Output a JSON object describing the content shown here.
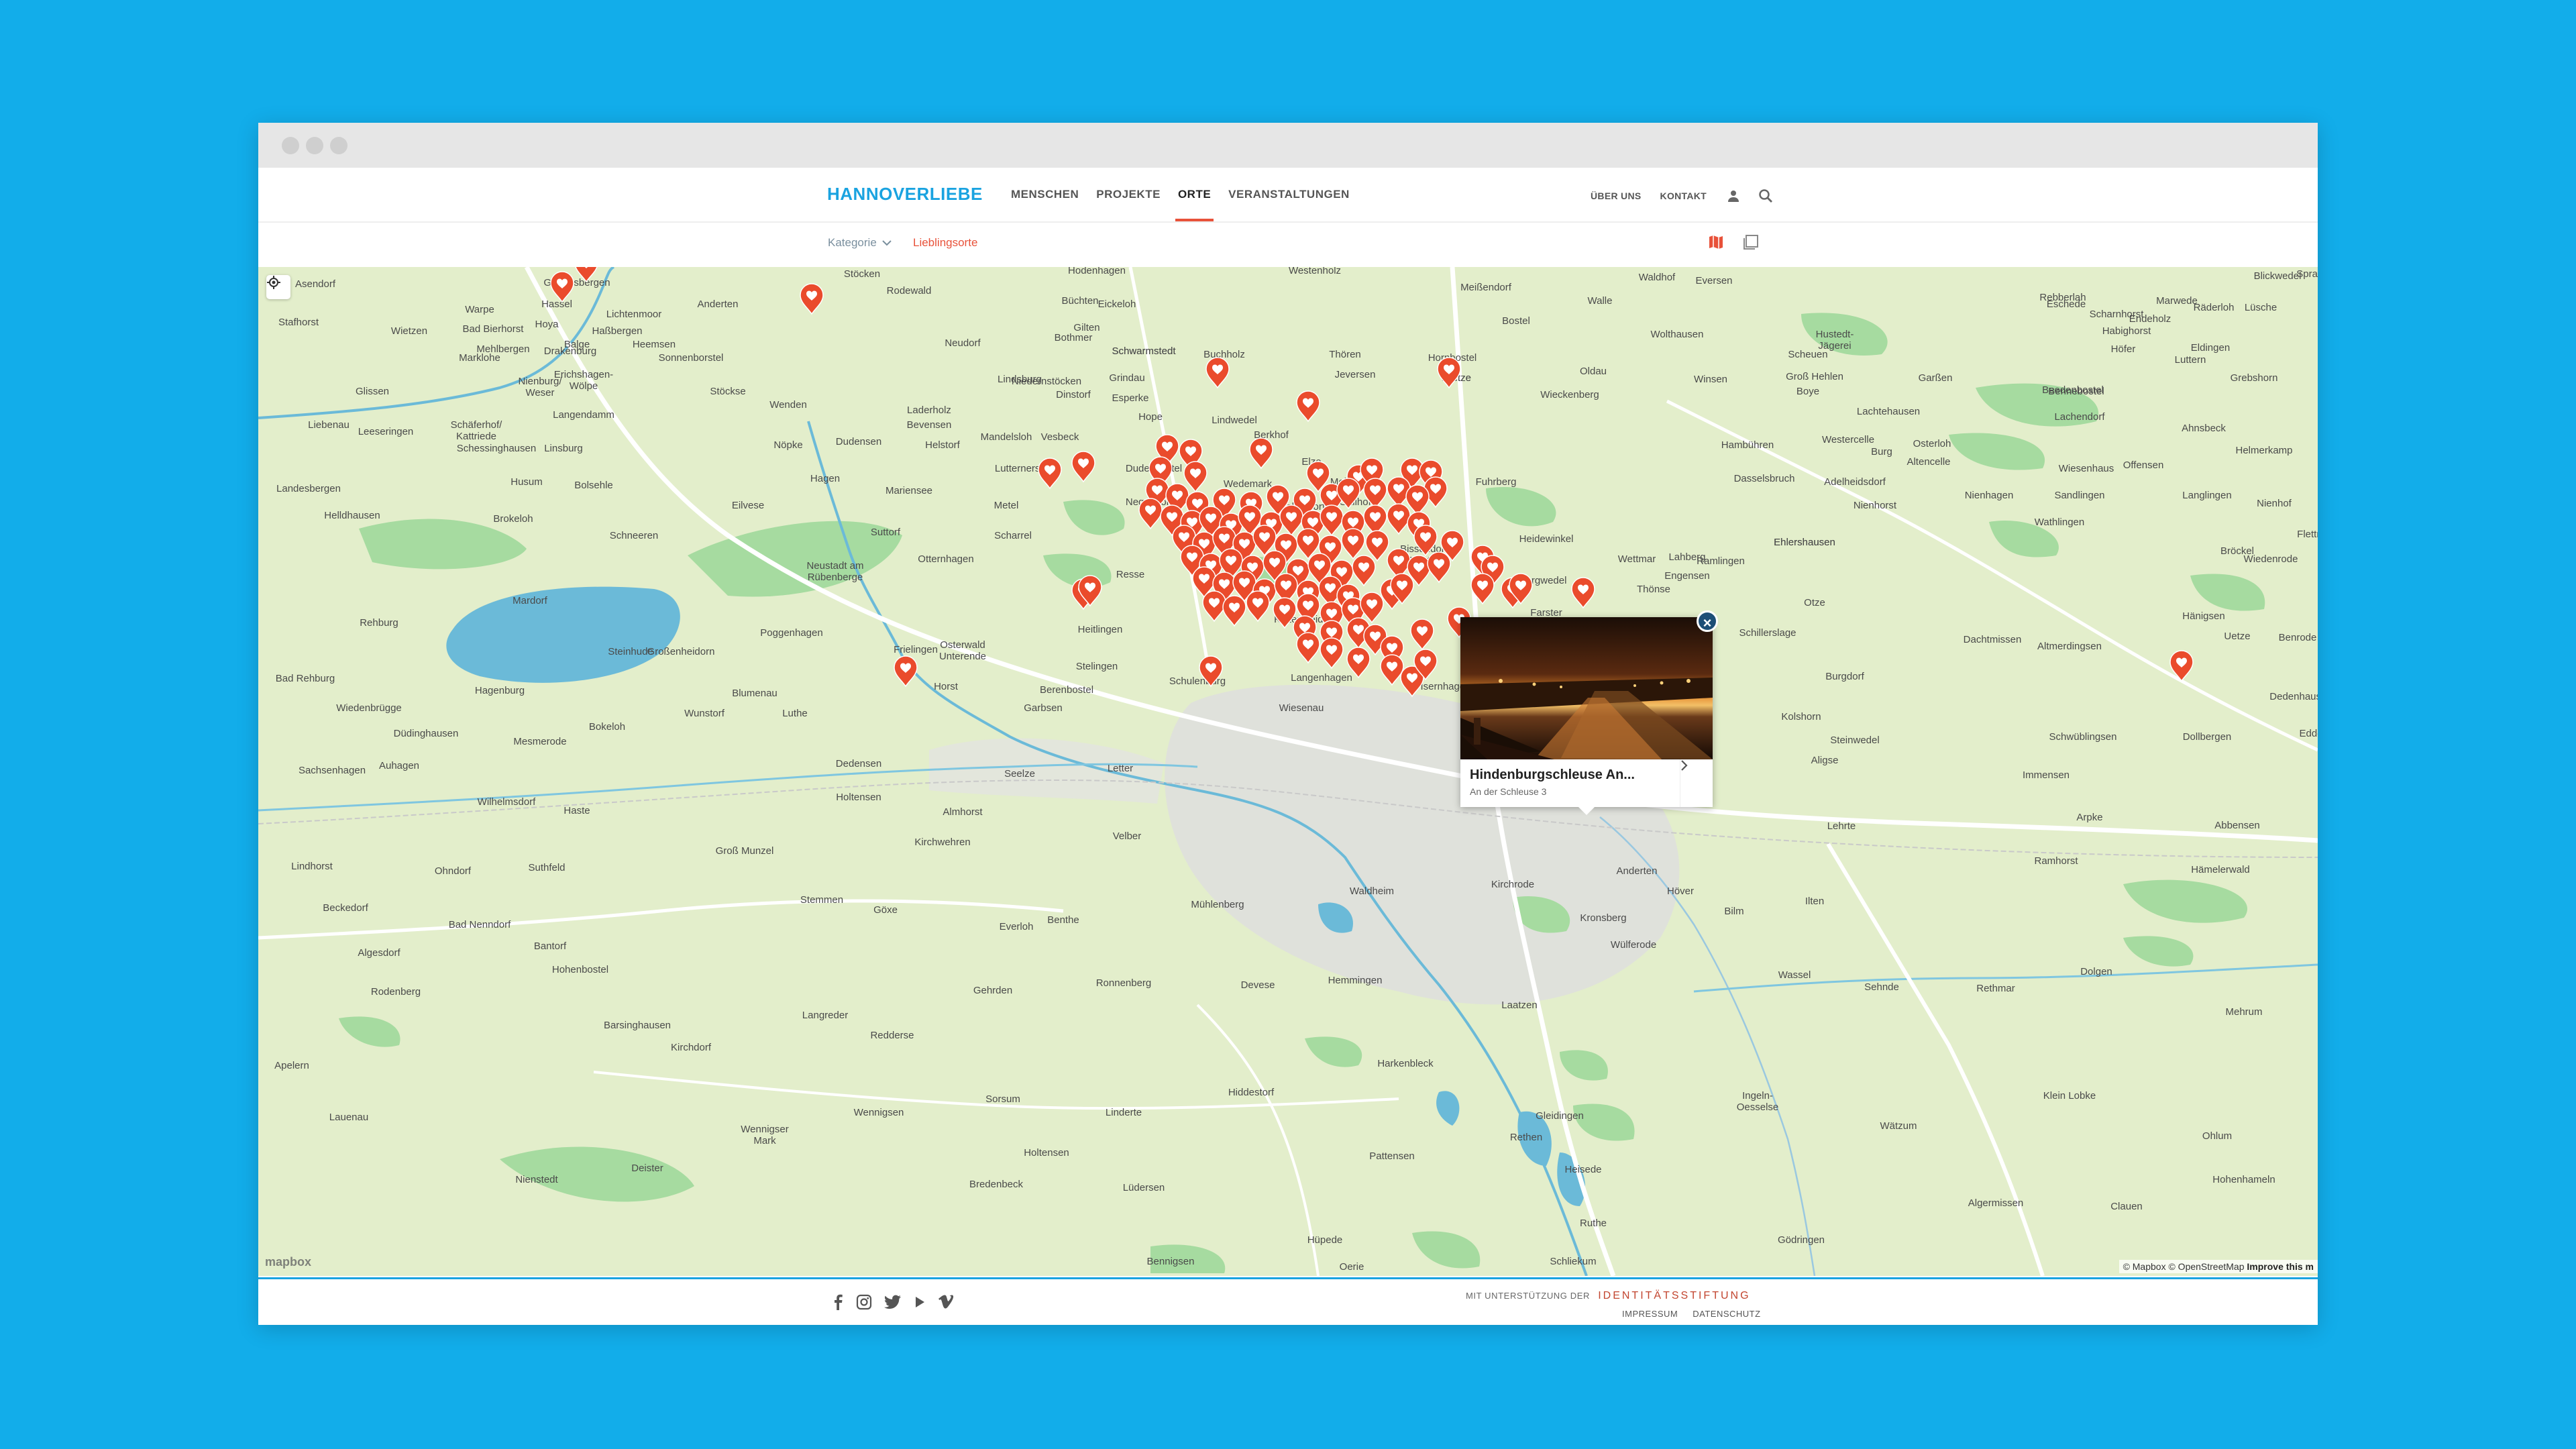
{
  "header": {
    "logo": "HANNOVERLIEBE",
    "nav": [
      {
        "label": "MENSCHEN",
        "active": false
      },
      {
        "label": "PROJEKTE",
        "active": false
      },
      {
        "label": "ORTE",
        "active": true
      },
      {
        "label": "VERANSTALTUNGEN",
        "active": false
      }
    ],
    "util": {
      "about": "ÜBER UNS",
      "contact": "KONTAKT"
    }
  },
  "subheader": {
    "category": "Kategorie",
    "favorites": "Lieblingsorte"
  },
  "map": {
    "attribution": {
      "mapbox": "© Mapbox",
      "osm": "© OpenStreetMap",
      "improve": "Improve this m"
    },
    "logo": "mapbox",
    "places": [
      [
        "Asendorf",
        85,
        30
      ],
      [
        "Stafhorst",
        60,
        87
      ],
      [
        "Warpe",
        330,
        68
      ],
      [
        "Bad Bierhorst",
        350,
        97
      ],
      [
        "Wietzen",
        225,
        100
      ],
      [
        "Gandesbergen",
        475,
        28
      ],
      [
        "Hassel",
        445,
        60
      ],
      [
        "Hoya",
        430,
        90
      ],
      [
        "Balge",
        475,
        120
      ],
      [
        "Haßbergen",
        535,
        100
      ],
      [
        "Marklohe",
        330,
        140
      ],
      [
        "Mehlbergen",
        365,
        127
      ],
      [
        "Drakenburg",
        465,
        130
      ],
      [
        "Heemsen",
        590,
        120
      ],
      [
        "Sonnenborstel",
        645,
        140
      ],
      [
        "Lichtenmoor",
        560,
        75
      ],
      [
        "Anderten",
        685,
        60
      ],
      [
        "Nienburg/\nWeser",
        420,
        175
      ],
      [
        "Erichshagen-\nWölpe",
        485,
        165
      ],
      [
        "Glissen",
        170,
        190
      ],
      [
        "Liebenau",
        105,
        240
      ],
      [
        "Leeseringen",
        190,
        250
      ],
      [
        "Schäferhof/\nKattriede",
        325,
        240
      ],
      [
        "Langendamm",
        485,
        225
      ],
      [
        "Stöckse",
        700,
        190
      ],
      [
        "Wenden",
        790,
        210
      ],
      [
        "Schessinghausen",
        355,
        275
      ],
      [
        "Linsburg",
        455,
        275
      ],
      [
        "Nöpke",
        790,
        270
      ],
      [
        "Dudensen",
        895,
        265
      ],
      [
        "Hagen",
        845,
        320
      ],
      [
        "Husum",
        400,
        325
      ],
      [
        "Bolsehle",
        500,
        330
      ],
      [
        "Brokeloh",
        380,
        380
      ],
      [
        "Eilvese",
        730,
        360
      ],
      [
        "Mariensee",
        970,
        338
      ],
      [
        "Schneeren",
        560,
        405
      ],
      [
        "Landesbergen",
        75,
        335
      ],
      [
        "Helldhausen",
        140,
        375
      ],
      [
        "Stöcken",
        900,
        15
      ],
      [
        "Rodewald",
        970,
        40
      ],
      [
        "Suttorf",
        935,
        400
      ],
      [
        "Mardorf",
        405,
        502
      ],
      [
        "Neustadt am\nRübenberge",
        860,
        450
      ],
      [
        "Rehburg",
        180,
        535
      ],
      [
        "Steinhude",
        555,
        578
      ],
      [
        "Großenheidorn",
        630,
        578
      ],
      [
        "Poggenhagen",
        795,
        550
      ],
      [
        "Bad Rehburg",
        70,
        618
      ],
      [
        "Hagenburg",
        360,
        636
      ],
      [
        "Wunstorf",
        665,
        670
      ],
      [
        "Blumenau",
        740,
        640
      ],
      [
        "Luthe",
        800,
        670
      ],
      [
        "Wiedenbrügge",
        165,
        662
      ],
      [
        "Bokeloh",
        520,
        690
      ],
      [
        "Düdinghausen",
        250,
        700
      ],
      [
        "Mesmerode",
        420,
        712
      ],
      [
        "Sachsenhagen",
        110,
        755
      ],
      [
        "Auhagen",
        210,
        748
      ],
      [
        "Dedensen",
        895,
        745
      ],
      [
        "Seelze",
        1135,
        760
      ],
      [
        "Letter",
        1285,
        752
      ],
      [
        "Wilhelmsdorf",
        370,
        802
      ],
      [
        "Haste",
        475,
        815
      ],
      [
        "Holtensen",
        895,
        795
      ],
      [
        "Almhorst",
        1050,
        817
      ],
      [
        "Kirchwehren",
        1020,
        862
      ],
      [
        "Velber",
        1295,
        853
      ],
      [
        "Lindhorst",
        80,
        898
      ],
      [
        "Ohndorf",
        290,
        905
      ],
      [
        "Suthfeld",
        430,
        900
      ],
      [
        "Groß Munzel",
        725,
        875
      ],
      [
        "Stemmen",
        840,
        948
      ],
      [
        "Göxe",
        935,
        963
      ],
      [
        "Beckedorf",
        130,
        960
      ],
      [
        "Bad Nenndorf",
        330,
        985
      ],
      [
        "Benthe",
        1200,
        978
      ],
      [
        "Everloh",
        1130,
        988
      ],
      [
        "Mühlenberg",
        1430,
        955
      ],
      [
        "Algesdorf",
        180,
        1027
      ],
      [
        "Bantorf",
        435,
        1017
      ],
      [
        "Hohenbostel",
        480,
        1052
      ],
      [
        "Rodenberg",
        205,
        1085
      ],
      [
        "Gehrden",
        1095,
        1083
      ],
      [
        "Ronnenberg",
        1290,
        1072
      ],
      [
        "Devese",
        1490,
        1075
      ],
      [
        "Hemmingen",
        1635,
        1068
      ],
      [
        "Barsinghausen",
        565,
        1135
      ],
      [
        "Langreder",
        845,
        1120
      ],
      [
        "Redderse",
        945,
        1150
      ],
      [
        "Kirchdorf",
        645,
        1168
      ],
      [
        "Apelern",
        50,
        1195
      ],
      [
        "Lauenau",
        135,
        1272
      ],
      [
        "Sorsum",
        1110,
        1245
      ],
      [
        "Wennigsen",
        925,
        1265
      ],
      [
        "Linderte",
        1290,
        1265
      ],
      [
        "Hiddestorf",
        1480,
        1235
      ],
      [
        "Harkenbleck",
        1710,
        1192
      ],
      [
        "Wennigser\nMark",
        755,
        1290
      ],
      [
        "Holtensen",
        1175,
        1325
      ],
      [
        "Pattensen",
        1690,
        1330
      ],
      [
        "Nienstedt",
        415,
        1365
      ],
      [
        "Deister",
        580,
        1348
      ],
      [
        "Bredenbeck",
        1100,
        1372
      ],
      [
        "Lüdersen",
        1320,
        1377
      ],
      [
        "Gleidingen",
        1940,
        1270
      ],
      [
        "Heisede",
        1975,
        1350
      ],
      [
        "Rethen",
        1890,
        1302
      ],
      [
        "Ruthe",
        1990,
        1430
      ],
      [
        "Hüpede",
        1590,
        1455
      ],
      [
        "Bennigsen",
        1360,
        1487
      ],
      [
        "Schliekum",
        1960,
        1487
      ],
      [
        "Oerie",
        1630,
        1495
      ],
      [
        "Laatzen",
        1880,
        1105
      ],
      [
        "Wülferode",
        2050,
        1015
      ],
      [
        "Kronsberg",
        2005,
        975
      ],
      [
        "Kirchrode",
        1870,
        925
      ],
      [
        "Waldheim",
        1660,
        935
      ],
      [
        "Anderten",
        2055,
        905
      ],
      [
        "Höver",
        2120,
        935
      ],
      [
        "Bilm",
        2200,
        965
      ],
      [
        "Ilten",
        2320,
        950
      ],
      [
        "Lehrte",
        2360,
        838
      ],
      [
        "Sehnde",
        2420,
        1078
      ],
      [
        "Wassel",
        2290,
        1060
      ],
      [
        "Rethmar",
        2590,
        1080
      ],
      [
        "Dolgen",
        2740,
        1055
      ],
      [
        "Mehrum",
        2960,
        1115
      ],
      [
        "Hämelerwald",
        2925,
        903
      ],
      [
        "Ingeln-\nOesselse",
        2235,
        1240
      ],
      [
        "Wätzum",
        2445,
        1285
      ],
      [
        "Klein Lobke",
        2700,
        1240
      ],
      [
        "Ohlum",
        2920,
        1300
      ],
      [
        "Algermissen",
        2590,
        1400
      ],
      [
        "Clauen",
        2785,
        1405
      ],
      [
        "Hohenhameln",
        2960,
        1365
      ],
      [
        "Gödringen",
        2300,
        1455
      ],
      [
        "Ramhorst",
        2680,
        890
      ],
      [
        "Arpke",
        2730,
        825
      ],
      [
        "Abbensen",
        2950,
        837
      ],
      [
        "Immensen",
        2665,
        762
      ],
      [
        "Dollbergen",
        2905,
        705
      ],
      [
        "Schwüblingsen",
        2720,
        705
      ],
      [
        "Steinwedel",
        2380,
        710
      ],
      [
        "Aligse",
        2335,
        740
      ],
      [
        "Kolshorn",
        2300,
        675
      ],
      [
        "Burgdorf",
        2365,
        615
      ],
      [
        "Dachtmissen",
        2585,
        560
      ],
      [
        "Altmerdingsen",
        2700,
        570
      ],
      [
        "Uetze",
        2950,
        555
      ],
      [
        "Benrode",
        3040,
        557
      ],
      [
        "Dedenhausen",
        3045,
        645
      ],
      [
        "Edde",
        3060,
        700
      ],
      [
        "Schillerslage",
        2250,
        550
      ],
      [
        "Hänigsen",
        2900,
        525
      ],
      [
        "Otze",
        2320,
        505
      ],
      [
        "Thönse",
        2080,
        485
      ],
      [
        "Engensen",
        2130,
        465
      ],
      [
        "Wettmar",
        2055,
        440
      ],
      [
        "Lahberg",
        2130,
        437
      ],
      [
        "Ramlingen",
        2180,
        443
      ],
      [
        "Ehlershausen",
        2305,
        415
      ],
      [
        "Heidewinkel",
        1920,
        410
      ],
      [
        "Burgwedel",
        1915,
        472
      ],
      [
        "Bissendorf-\nWietze",
        1740,
        425
      ],
      [
        "Kiebitzkrug",
        1555,
        480
      ],
      [
        "Kaltenweide",
        1555,
        530
      ],
      [
        "Langenhagen",
        1585,
        617
      ],
      [
        "Wiesenau",
        1555,
        662
      ],
      [
        "Isernhagen",
        1770,
        630
      ],
      [
        "Farster",
        1920,
        520
      ],
      [
        "Schulenburg",
        1400,
        622
      ],
      [
        "Heitlingen",
        1255,
        545
      ],
      [
        "Stelingen",
        1250,
        600
      ],
      [
        "Berenbostel",
        1205,
        635
      ],
      [
        "Garbsen",
        1170,
        662
      ],
      [
        "Osterwald\nUnterende",
        1050,
        568
      ],
      [
        "Frielingen",
        980,
        575
      ],
      [
        "Horst",
        1025,
        630
      ],
      [
        "Otternhagen",
        1025,
        440
      ],
      [
        "Resse",
        1300,
        463
      ],
      [
        "Scharrel",
        1125,
        405
      ],
      [
        "Metel",
        1115,
        360
      ],
      [
        "Negenborn",
        1330,
        355
      ],
      [
        "Dudenbostel",
        1335,
        305
      ],
      [
        "Lutternersen",
        1140,
        305
      ],
      [
        "Mandelsloh",
        1115,
        258
      ],
      [
        "Bevensen",
        1000,
        240
      ],
      [
        "Laderholz",
        1000,
        218
      ],
      [
        "Helstorf",
        1020,
        270
      ],
      [
        "Vesbeck",
        1195,
        258
      ],
      [
        "Hope",
        1330,
        228
      ],
      [
        "Lindwedel",
        1455,
        233
      ],
      [
        "Berkhof",
        1510,
        255
      ],
      [
        "Elze",
        1570,
        295
      ],
      [
        "Meitze",
        1620,
        325
      ],
      [
        "Gailhof",
        1635,
        355
      ],
      [
        "Wedemark",
        1475,
        328
      ],
      [
        "Mellendorf",
        1555,
        362
      ],
      [
        "Scherenbostel",
        1570,
        415
      ],
      [
        "Fuhrberg",
        1845,
        325
      ],
      [
        "Wieckenberg",
        1955,
        195
      ],
      [
        "Oldau",
        1990,
        160
      ],
      [
        "Wietze",
        1785,
        170
      ],
      [
        "Hornbostel",
        1780,
        140
      ],
      [
        "Thören",
        1620,
        135
      ],
      [
        "Jeversen",
        1635,
        165
      ],
      [
        "Sprakensehl",
        3080,
        15
      ],
      [
        "Blickwedel",
        3010,
        18
      ],
      [
        "Rebberlah",
        2690,
        50
      ],
      [
        "Eschede",
        2695,
        60
      ],
      [
        "Scharnhorst",
        2770,
        75
      ],
      [
        "Endeholz",
        2820,
        82
      ],
      [
        "Habighorst",
        2785,
        100
      ],
      [
        "Marwede",
        2860,
        55
      ],
      [
        "Räderloh",
        2915,
        65
      ],
      [
        "Lüsche",
        2985,
        65
      ],
      [
        "Höfer",
        2780,
        127
      ],
      [
        "Luttern",
        2880,
        143
      ],
      [
        "Eldingen",
        2910,
        125
      ],
      [
        "Grebshorn",
        2975,
        170
      ],
      [
        "Bennebostel",
        2710,
        190
      ],
      [
        "Beedenbostel",
        2705,
        188
      ],
      [
        "Lachendorf",
        2715,
        228
      ],
      [
        "Ahnsbeck",
        2900,
        245
      ],
      [
        "Helmerkamp",
        2990,
        278
      ],
      [
        "Wiedenrode",
        3000,
        440
      ],
      [
        "Bröckel",
        2950,
        428
      ],
      [
        "Nienhagen",
        2580,
        345
      ],
      [
        "Wathlingen",
        2685,
        385
      ],
      [
        "Sandlingen",
        2715,
        345
      ],
      [
        "Langlingen",
        2905,
        345
      ],
      [
        "Nienhof",
        3005,
        357
      ],
      [
        "Flettm",
        3060,
        403
      ],
      [
        "Ehlershausen",
        2305,
        415
      ],
      [
        "Adelheidsdorf",
        2380,
        325
      ],
      [
        "Nienhorst",
        2410,
        360
      ],
      [
        "Wiesenhaus",
        2725,
        305
      ],
      [
        "Offensen",
        2810,
        300
      ],
      [
        "Westercelle",
        2370,
        262
      ],
      [
        "Osterloh",
        2495,
        268
      ],
      [
        "Burg",
        2420,
        280
      ],
      [
        "Lachtehausen",
        2430,
        220
      ],
      [
        "Boye",
        2310,
        190
      ],
      [
        "Groß Hehlen",
        2320,
        168
      ],
      [
        "Scheuen",
        2310,
        135
      ],
      [
        "Hustedt-\nJägerei",
        2350,
        105
      ],
      [
        "Garßen",
        2500,
        170
      ],
      [
        "Altencelle",
        2490,
        295
      ],
      [
        "Dasselsbruch",
        2245,
        320
      ],
      [
        "Hambühren",
        2220,
        270
      ],
      [
        "Wolthausen",
        2115,
        105
      ],
      [
        "Walle",
        2000,
        55
      ],
      [
        "Waldhof",
        2085,
        20
      ],
      [
        "Eversen",
        2170,
        25
      ],
      [
        "Bostel",
        1875,
        85
      ],
      [
        "Meißendorf",
        1830,
        35
      ],
      [
        "Westenholz",
        1575,
        10
      ],
      [
        "Winsen",
        2165,
        172
      ],
      [
        "Wietze",
        1785,
        170
      ],
      [
        "Hodenhagen",
        1250,
        10
      ],
      [
        "Eickeloh",
        1280,
        60
      ],
      [
        "Gilten",
        1235,
        95
      ],
      [
        "Bothmer",
        1215,
        110
      ],
      [
        "Grindau",
        1295,
        170
      ],
      [
        "Esperke",
        1300,
        200
      ],
      [
        "Niedernstöcken",
        1175,
        175
      ],
      [
        "Schwarmstedt",
        1320,
        130
      ],
      [
        "Buchholz",
        1440,
        135
      ],
      [
        "Dinstorf",
        1215,
        195
      ],
      [
        "Lindsburg",
        1135,
        172
      ],
      [
        "Neudorf",
        1050,
        118
      ],
      [
        "Büchten",
        1225,
        55
      ],
      [
        "Schwarmstedt",
        1320,
        130
      ]
    ],
    "popup": {
      "title": "Hindenburgschleuse An...",
      "address": "An der Schleuse 3"
    }
  },
  "footer": {
    "support_prefix": "MIT UNTERSTÜTZUNG DER",
    "support_brand": "IDENTITÄTSSTIFTUNG",
    "impressum": "IMPRESSUM",
    "datenschutz": "DATENSCHUTZ"
  },
  "colors": {
    "accent": "#e8523a",
    "brand": "#1aa3e0",
    "background": "#12adea"
  }
}
